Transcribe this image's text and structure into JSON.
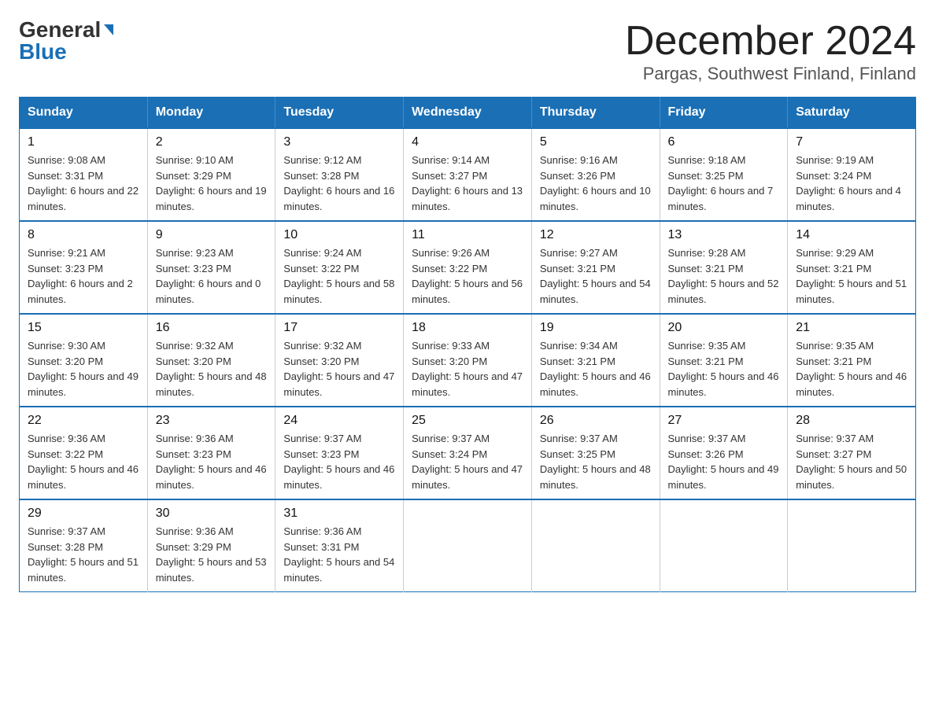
{
  "logo": {
    "general": "General",
    "blue": "Blue"
  },
  "title": "December 2024",
  "subtitle": "Pargas, Southwest Finland, Finland",
  "days_of_week": [
    "Sunday",
    "Monday",
    "Tuesday",
    "Wednesday",
    "Thursday",
    "Friday",
    "Saturday"
  ],
  "weeks": [
    [
      {
        "day": "1",
        "sunrise": "9:08 AM",
        "sunset": "3:31 PM",
        "daylight": "6 hours and 22 minutes."
      },
      {
        "day": "2",
        "sunrise": "9:10 AM",
        "sunset": "3:29 PM",
        "daylight": "6 hours and 19 minutes."
      },
      {
        "day": "3",
        "sunrise": "9:12 AM",
        "sunset": "3:28 PM",
        "daylight": "6 hours and 16 minutes."
      },
      {
        "day": "4",
        "sunrise": "9:14 AM",
        "sunset": "3:27 PM",
        "daylight": "6 hours and 13 minutes."
      },
      {
        "day": "5",
        "sunrise": "9:16 AM",
        "sunset": "3:26 PM",
        "daylight": "6 hours and 10 minutes."
      },
      {
        "day": "6",
        "sunrise": "9:18 AM",
        "sunset": "3:25 PM",
        "daylight": "6 hours and 7 minutes."
      },
      {
        "day": "7",
        "sunrise": "9:19 AM",
        "sunset": "3:24 PM",
        "daylight": "6 hours and 4 minutes."
      }
    ],
    [
      {
        "day": "8",
        "sunrise": "9:21 AM",
        "sunset": "3:23 PM",
        "daylight": "6 hours and 2 minutes."
      },
      {
        "day": "9",
        "sunrise": "9:23 AM",
        "sunset": "3:23 PM",
        "daylight": "6 hours and 0 minutes."
      },
      {
        "day": "10",
        "sunrise": "9:24 AM",
        "sunset": "3:22 PM",
        "daylight": "5 hours and 58 minutes."
      },
      {
        "day": "11",
        "sunrise": "9:26 AM",
        "sunset": "3:22 PM",
        "daylight": "5 hours and 56 minutes."
      },
      {
        "day": "12",
        "sunrise": "9:27 AM",
        "sunset": "3:21 PM",
        "daylight": "5 hours and 54 minutes."
      },
      {
        "day": "13",
        "sunrise": "9:28 AM",
        "sunset": "3:21 PM",
        "daylight": "5 hours and 52 minutes."
      },
      {
        "day": "14",
        "sunrise": "9:29 AM",
        "sunset": "3:21 PM",
        "daylight": "5 hours and 51 minutes."
      }
    ],
    [
      {
        "day": "15",
        "sunrise": "9:30 AM",
        "sunset": "3:20 PM",
        "daylight": "5 hours and 49 minutes."
      },
      {
        "day": "16",
        "sunrise": "9:32 AM",
        "sunset": "3:20 PM",
        "daylight": "5 hours and 48 minutes."
      },
      {
        "day": "17",
        "sunrise": "9:32 AM",
        "sunset": "3:20 PM",
        "daylight": "5 hours and 47 minutes."
      },
      {
        "day": "18",
        "sunrise": "9:33 AM",
        "sunset": "3:20 PM",
        "daylight": "5 hours and 47 minutes."
      },
      {
        "day": "19",
        "sunrise": "9:34 AM",
        "sunset": "3:21 PM",
        "daylight": "5 hours and 46 minutes."
      },
      {
        "day": "20",
        "sunrise": "9:35 AM",
        "sunset": "3:21 PM",
        "daylight": "5 hours and 46 minutes."
      },
      {
        "day": "21",
        "sunrise": "9:35 AM",
        "sunset": "3:21 PM",
        "daylight": "5 hours and 46 minutes."
      }
    ],
    [
      {
        "day": "22",
        "sunrise": "9:36 AM",
        "sunset": "3:22 PM",
        "daylight": "5 hours and 46 minutes."
      },
      {
        "day": "23",
        "sunrise": "9:36 AM",
        "sunset": "3:23 PM",
        "daylight": "5 hours and 46 minutes."
      },
      {
        "day": "24",
        "sunrise": "9:37 AM",
        "sunset": "3:23 PM",
        "daylight": "5 hours and 46 minutes."
      },
      {
        "day": "25",
        "sunrise": "9:37 AM",
        "sunset": "3:24 PM",
        "daylight": "5 hours and 47 minutes."
      },
      {
        "day": "26",
        "sunrise": "9:37 AM",
        "sunset": "3:25 PM",
        "daylight": "5 hours and 48 minutes."
      },
      {
        "day": "27",
        "sunrise": "9:37 AM",
        "sunset": "3:26 PM",
        "daylight": "5 hours and 49 minutes."
      },
      {
        "day": "28",
        "sunrise": "9:37 AM",
        "sunset": "3:27 PM",
        "daylight": "5 hours and 50 minutes."
      }
    ],
    [
      {
        "day": "29",
        "sunrise": "9:37 AM",
        "sunset": "3:28 PM",
        "daylight": "5 hours and 51 minutes."
      },
      {
        "day": "30",
        "sunrise": "9:36 AM",
        "sunset": "3:29 PM",
        "daylight": "5 hours and 53 minutes."
      },
      {
        "day": "31",
        "sunrise": "9:36 AM",
        "sunset": "3:31 PM",
        "daylight": "5 hours and 54 minutes."
      },
      null,
      null,
      null,
      null
    ]
  ]
}
